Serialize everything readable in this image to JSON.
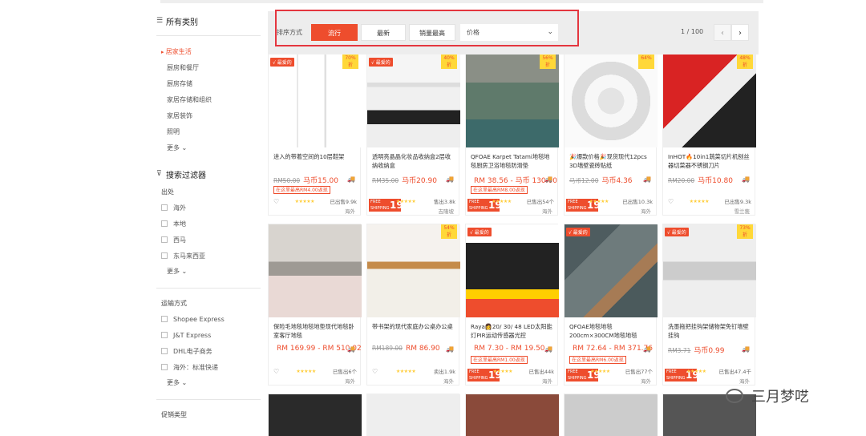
{
  "sidebar": {
    "categories_title": "所有类别",
    "categories": [
      "居家生活",
      "厨房和餐厅",
      "厨房存储",
      "家居存储和组织",
      "家居装饰",
      "照明"
    ],
    "more_label": "更多",
    "filter_title": "搜索过滤器",
    "origin_label": "出处",
    "origin_options": [
      "海外",
      "本地",
      "西马",
      "东马来西亚"
    ],
    "origin_more": "更多",
    "shipping_label": "运输方式",
    "shipping_options": [
      "Shopee Express",
      "J&T Express",
      "DHL电子商务",
      "海外：标准快递"
    ],
    "shipping_more": "更多",
    "promo_label": "促销类型"
  },
  "sortbar": {
    "label": "排序方式",
    "buttons": [
      "流行",
      "最新",
      "销量最高"
    ],
    "price_placeholder": "价格",
    "page_indicator": "1 / 100"
  },
  "products": [
    {
      "badge": "√ 最爱的",
      "discount": "70% 折",
      "title": "进入的带着空间的10层鞋架",
      "old": "RM50.00",
      "price": "马币15.00",
      "tag": "在这里最高RM4.00返现",
      "rating": "已出售9.9k",
      "loc": "海外",
      "freeship": false
    },
    {
      "badge": "√ 最爱的",
      "discount": "40% 折",
      "title": "透明亮晶晶化妆品收纳盒2层收纳收纳盒",
      "old": "RM35.00",
      "price": "马币20.90",
      "tag": "",
      "rating": "售出3.8k",
      "loc": "吉隆坡",
      "freeship": true
    },
    {
      "badge": "",
      "discount": "56% 折",
      "title": "QFOAE Karpet Tatami地毯地毯厨房卫浴地毯防滑垫",
      "old": "",
      "price": "RM 38.56 - 马币 130.00",
      "tag": "在这里最高RM8.00返现",
      "rating": "已售出54个",
      "loc": "海外",
      "freeship": true
    },
    {
      "badge": "",
      "discount": "64%",
      "title": "🎉爆款价格🎉现货现代12pcs 3D墙壁瓷砖贴纸",
      "old": "马币12.00",
      "price": "马币4.36",
      "tag": "",
      "rating": "已出售10.3k",
      "loc": "海外",
      "freeship": true
    },
    {
      "badge": "",
      "discount": "48% 折",
      "title": "InHOT🔥10in1蔬菜切片机刨丝器切菜器不锈钢刀片",
      "old": "RM20.00",
      "price": "马币10.80",
      "tag": "",
      "rating": "已出售9.3k",
      "loc": "雪兰莪",
      "freeship": false
    },
    {
      "badge": "",
      "discount": "",
      "title": "保险毛地毯地毯地垫现代地毯卧室客厅地毯",
      "old": "",
      "price": "RM 169.99 - RM 510.02",
      "tag": "",
      "rating": "已售出6个",
      "loc": "海外",
      "freeship": false
    },
    {
      "badge": "",
      "discount": "54% 折",
      "title": "带书架的现代家庭办公桌办公桌",
      "old": "RM189.00",
      "price": "RM 86.90",
      "tag": "",
      "rating": "卖出1.9k",
      "loc": "海外",
      "freeship": false
    },
    {
      "badge": "√ 最爱的",
      "discount": "",
      "title": "Raya👩20/ 30/ 48 LED太阳能灯PIR运动传感器光控",
      "old": "",
      "price": "RM 7.30 - RM 19.50",
      "tag": "在这里最高RM1.00返现",
      "rating": "已售出44k",
      "loc": "海外",
      "freeship": true
    },
    {
      "badge": "√ 最爱的",
      "discount": "",
      "title": "QFOAE地毯地毯200cm×300CM地毯地毯",
      "old": "",
      "price": "RM 72.64 - RM 371.76",
      "tag": "在这里最高RM6.00返现",
      "rating": "已售出77个",
      "loc": "海外",
      "freeship": true
    },
    {
      "badge": "√ 最爱的",
      "discount": "73% 折",
      "title": "洗墨拖把挂钩架储物架免钉墙壁挂钩",
      "old": "RM3.71",
      "price": "马币0.99",
      "tag": "",
      "rating": "已售出47.4千",
      "loc": "海外",
      "freeship": true
    }
  ],
  "watermark": "三月梦呓"
}
